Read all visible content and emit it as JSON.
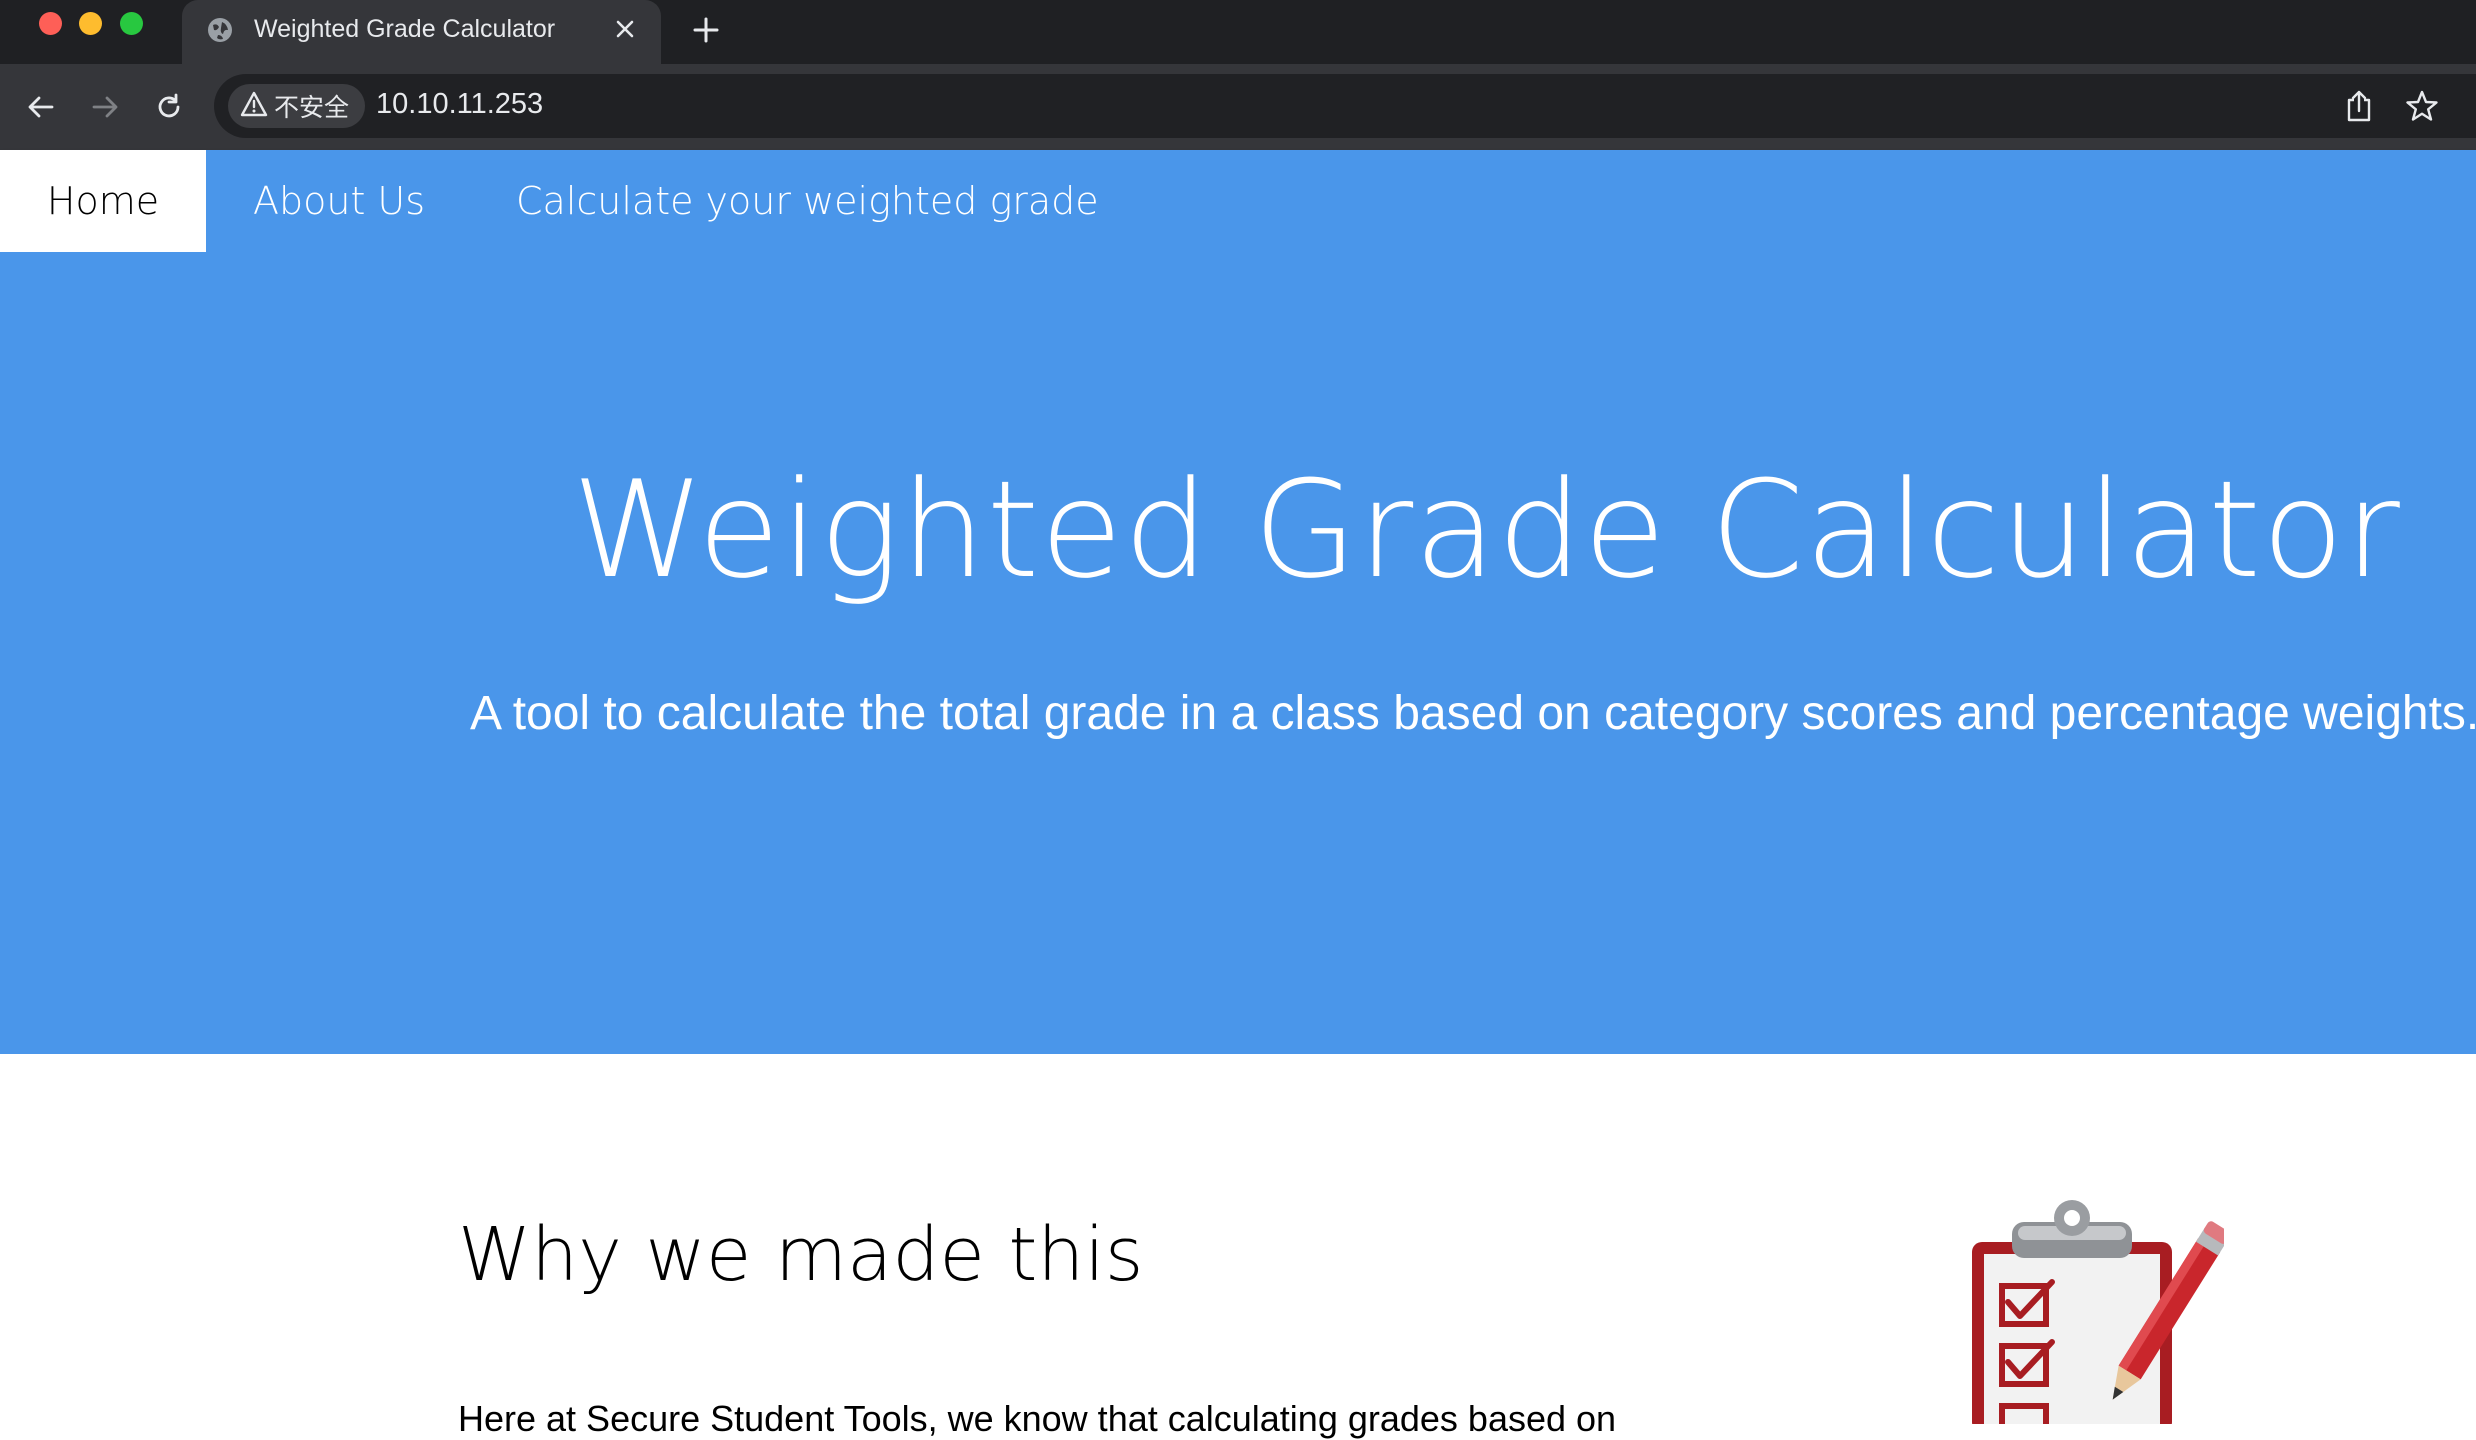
{
  "browser": {
    "tab": {
      "title": "Weighted Grade Calculator",
      "favicon": "globe-icon",
      "close_glyph": "✕"
    },
    "security_label": "不安全",
    "url": "10.10.11.253"
  },
  "nav": {
    "items": [
      {
        "label": "Home",
        "active": true
      },
      {
        "label": "About Us",
        "active": false
      },
      {
        "label": "Calculate your weighted grade",
        "active": false
      }
    ]
  },
  "hero": {
    "title": "Weighted Grade Calculator",
    "subtitle": "A tool to calculate the total grade in a class based on category scores and percentage weights."
  },
  "content": {
    "heading": "Why we made this",
    "paragraph": "Here at Secure Student Tools, we know that calculating grades based on"
  },
  "colors": {
    "brand_blue": "#4a96ea",
    "chrome_dark": "#1f2023",
    "chrome_toolbar": "#35363a",
    "clipboard_red": "#b01e23"
  },
  "icons": {
    "hero_illustration": "clipboard-checklist-pencil-icon"
  }
}
